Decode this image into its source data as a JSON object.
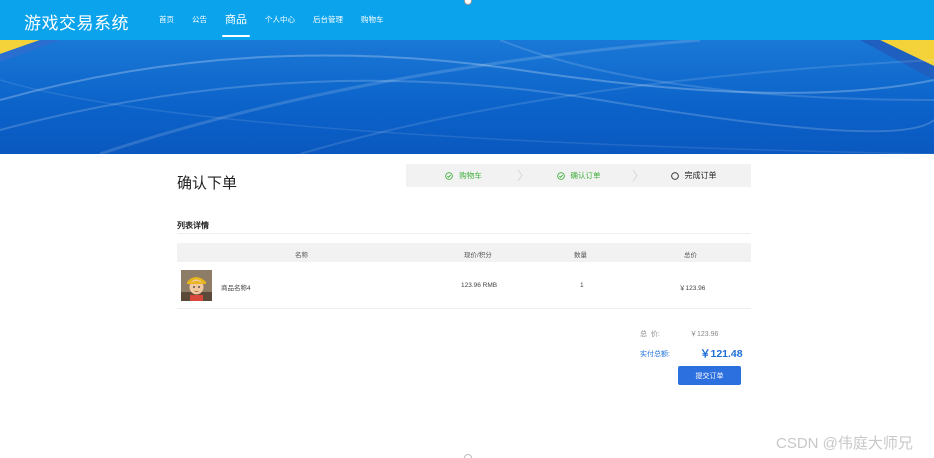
{
  "brand": {
    "title": "游戏交易系统"
  },
  "nav": {
    "items": [
      {
        "label": "首页"
      },
      {
        "label": "公告"
      },
      {
        "label": "商品"
      },
      {
        "label": "个人中心"
      },
      {
        "label": "后台管理"
      },
      {
        "label": "购物车"
      }
    ],
    "active_index": 2
  },
  "page": {
    "title": "确认下单"
  },
  "steps": [
    {
      "label": "购物车",
      "status": "done"
    },
    {
      "label": "确认订单",
      "status": "done"
    },
    {
      "label": "完成订单",
      "status": "current"
    }
  ],
  "list": {
    "title": "列表详情",
    "columns": [
      "名称",
      "现价/积分",
      "数量",
      "总价"
    ],
    "rows": [
      {
        "name": "商品名称4",
        "price": "123.96 RMB",
        "quantity": "1",
        "total": "￥123.96"
      }
    ]
  },
  "summary": {
    "total_label": "总  价:",
    "total_value": "￥123.96",
    "pay_label": "实付总额:",
    "pay_value": "￥121.48",
    "submit_label": "提交订单"
  },
  "watermark": "CSDN @伟庭大师兄",
  "colors": {
    "topbar": "#0aa3ec",
    "accent": "#2c6fde",
    "step_done": "#3dae3a"
  }
}
